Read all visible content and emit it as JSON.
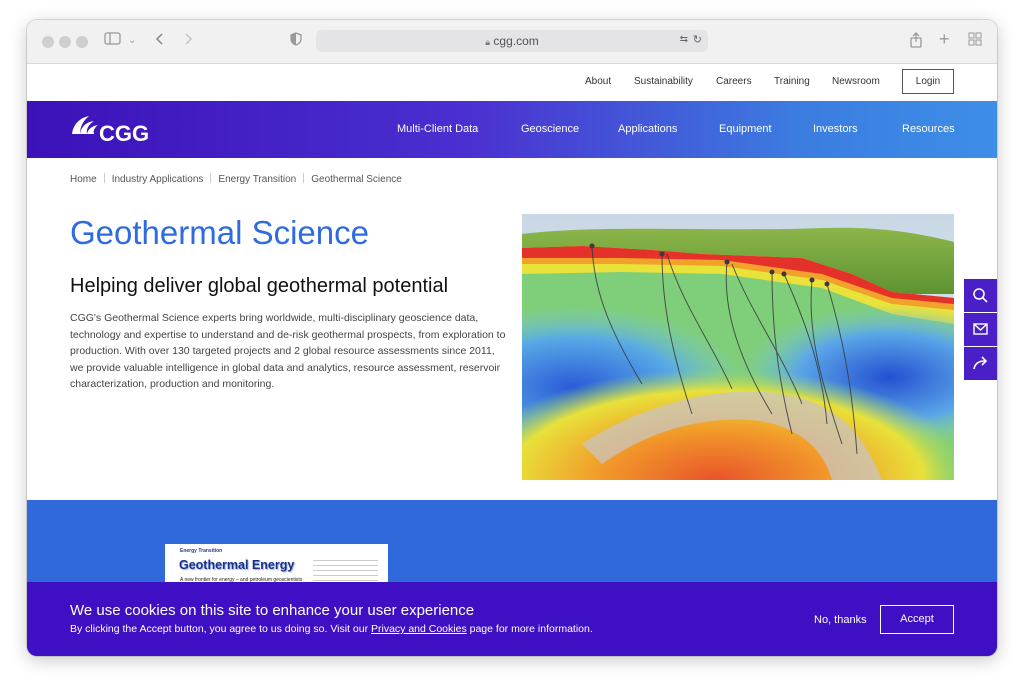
{
  "browser": {
    "url": "cgg.com"
  },
  "utility_nav": {
    "items": [
      "About",
      "Sustainability",
      "Careers",
      "Training",
      "Newsroom"
    ],
    "login_label": "Login"
  },
  "main_nav": {
    "logo_text": "CGG",
    "items": [
      "Multi-Client Data",
      "Geoscience",
      "Applications",
      "Equipment",
      "Investors",
      "Resources"
    ]
  },
  "breadcrumb": [
    "Home",
    "Industry Applications",
    "Energy Transition",
    "Geothermal Science"
  ],
  "content": {
    "title": "Geothermal Science",
    "subtitle": "Helping deliver global geothermal potential",
    "body": "CGG's Geothermal Science experts bring worldwide, multi-disciplinary geoscience data, technology and expertise to understand and de-risk geothermal prospects, from exploration to production. With over 130 targeted projects and 2 global resource assessments since 2011, we provide valuable intelligence in global data and analytics, resource assessment, reservoir characterization, production and monitoring."
  },
  "brochure": {
    "tag": "Energy Transition",
    "title": "Geothermal Energy",
    "subtitle": "A new frontier for energy – and petroleum geoscientists"
  },
  "side_tools": [
    "search-icon",
    "mail-icon",
    "share-icon"
  ],
  "cookie_banner": {
    "title": "We use cookies on this site to enhance your user experience",
    "text_before": "By clicking the Accept button, you agree to us doing so. Visit our ",
    "link": "Privacy and Cookies",
    "text_after": " page for more information.",
    "decline_label": "No, thanks",
    "accept_label": "Accept"
  },
  "colors": {
    "brand_purple": "#3f0fc4",
    "title_blue": "#2e6be0",
    "band_blue": "#2f69dc"
  }
}
